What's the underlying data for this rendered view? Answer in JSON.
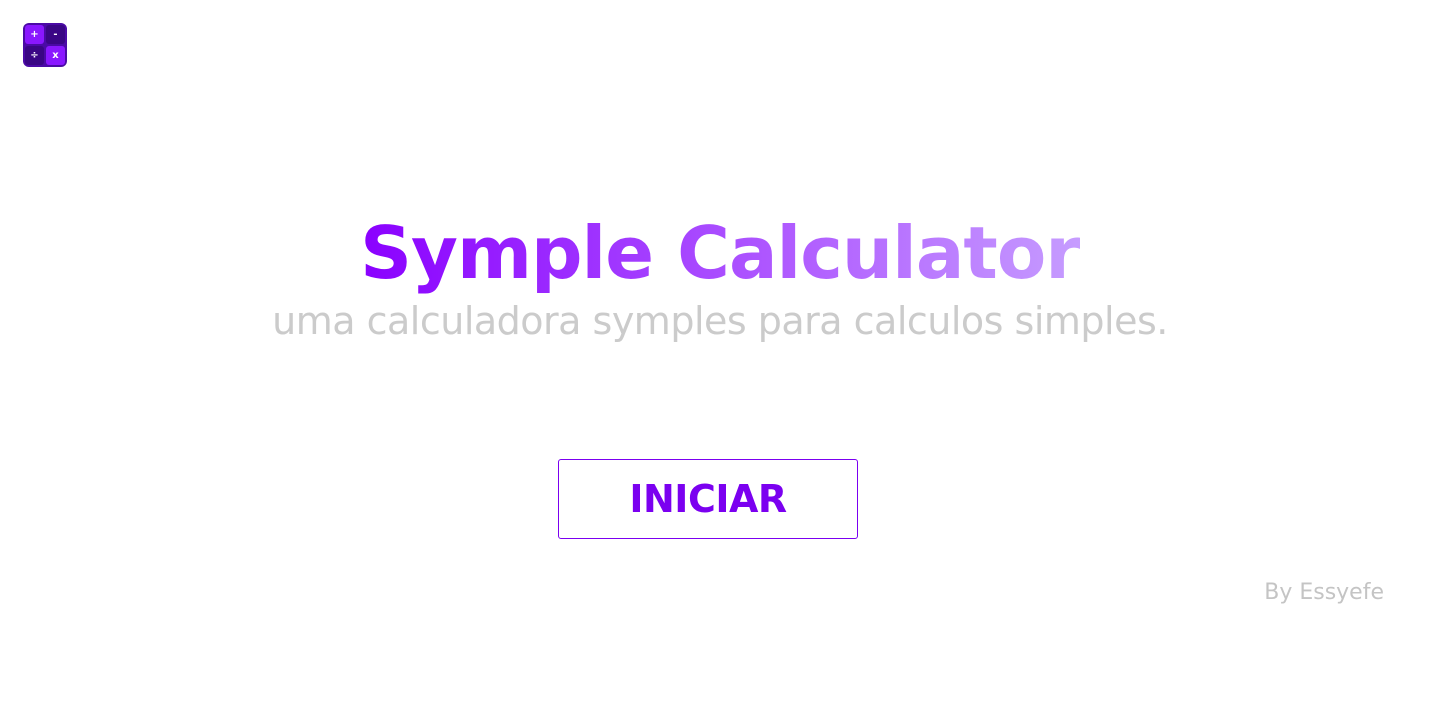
{
  "logo": {
    "icon": "calculator-icon",
    "symbols": [
      "+",
      "-",
      "÷",
      "x"
    ]
  },
  "hero": {
    "title": "Symple Calculator",
    "subtitle": "uma calculadora symples para calculos simples."
  },
  "actions": {
    "start_label": "INICIAR"
  },
  "footer": {
    "credit": "By Essyefe"
  },
  "colors": {
    "accent": "#7b00f0",
    "title_gradient_start": "#8a00ff",
    "title_gradient_end": "#c69cff",
    "muted_text": "#cbcbcb",
    "background": "#ffffff"
  }
}
